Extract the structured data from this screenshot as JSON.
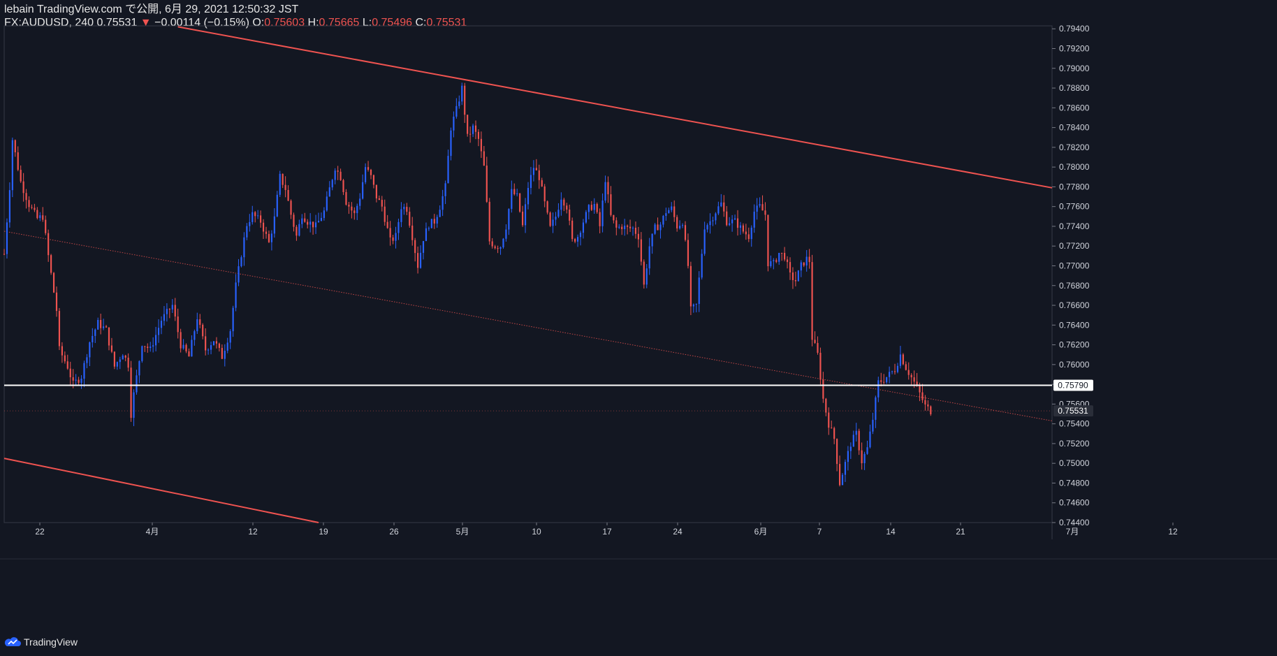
{
  "header": {
    "line1": "lebain TradingView.com で公開, 6月 29, 2021 12:50:32 JST",
    "symbol": "FX:AUDUSD, 240",
    "last": "0.75531",
    "change_arrow": "▼",
    "change": "−0.00114 (−0.15%)",
    "o_label": "O:",
    "o_value": "0.75603",
    "h_label": "H:",
    "h_value": "0.75665",
    "l_label": "L:",
    "l_value": "0.75496",
    "c_label": "C:",
    "c_value": "0.75531"
  },
  "footer": {
    "brand": "TradingView",
    "logo_icon": "tradingview-cloud-icon"
  },
  "colors": {
    "background": "#131722",
    "up": "#2962ff",
    "down": "#ef5350",
    "trendline": "#ef5350",
    "hline": "#ffffff",
    "grid_text": "#d1d4dc"
  },
  "chart_data": {
    "type": "candlestick",
    "symbol": "FX:AUDUSD",
    "timeframe": "240",
    "y_ticks": [
      "0.74400",
      "0.74600",
      "0.74800",
      "0.75000",
      "0.75200",
      "0.75400",
      "0.75600",
      "0.75800",
      "0.76000",
      "0.76200",
      "0.76400",
      "0.76600",
      "0.76800",
      "0.77000",
      "0.77200",
      "0.77400",
      "0.77600",
      "0.77800",
      "0.78000",
      "0.78200",
      "0.78400",
      "0.78600",
      "0.78800",
      "0.79000",
      "0.79200",
      "0.79400"
    ],
    "ylim": [
      0.744,
      0.7943
    ],
    "x_ticks": [
      "22",
      "4月",
      "12",
      "19",
      "26",
      "5月",
      "10",
      "17",
      "24",
      "6月",
      "7",
      "14",
      "21",
      "7月",
      "12"
    ],
    "horizontal_line": {
      "value": 0.7579,
      "label": "0.75790"
    },
    "last_price": {
      "value": 0.75531,
      "label": "0.75531"
    },
    "trendlines": [
      {
        "name": "upper",
        "from": {
          "t": 63,
          "y": 0.7942
        },
        "to": {
          "t": 380,
          "y": 0.7779
        }
      },
      {
        "name": "lower",
        "from": {
          "t": 0,
          "y": 0.7505
        },
        "to": {
          "t": 114,
          "y": 0.744
        }
      },
      {
        "name": "mid-dotted",
        "from": {
          "t": 0,
          "y": 0.7735
        },
        "to": {
          "t": 380,
          "y": 0.7543
        }
      }
    ],
    "price_path": [
      [
        0,
        0.7712
      ],
      [
        2,
        0.778
      ],
      [
        3,
        0.7828
      ],
      [
        6,
        0.7785
      ],
      [
        9,
        0.7762
      ],
      [
        12,
        0.7748
      ],
      [
        14,
        0.775
      ],
      [
        16,
        0.771
      ],
      [
        19,
        0.7655
      ],
      [
        20,
        0.7615
      ],
      [
        23,
        0.7598
      ],
      [
        25,
        0.758
      ],
      [
        28,
        0.7588
      ],
      [
        31,
        0.7623
      ],
      [
        34,
        0.7642
      ],
      [
        37,
        0.7635
      ],
      [
        40,
        0.7598
      ],
      [
        43,
        0.7612
      ],
      [
        45,
        0.76
      ],
      [
        46,
        0.755
      ],
      [
        47,
        0.757
      ],
      [
        50,
        0.7622
      ],
      [
        53,
        0.7615
      ],
      [
        57,
        0.7645
      ],
      [
        61,
        0.766
      ],
      [
        64,
        0.762
      ],
      [
        67,
        0.7608
      ],
      [
        70,
        0.7648
      ],
      [
        73,
        0.7615
      ],
      [
        76,
        0.7625
      ],
      [
        79,
        0.7608
      ],
      [
        82,
        0.7635
      ],
      [
        84,
        0.768
      ],
      [
        86,
        0.7712
      ],
      [
        88,
        0.7742
      ],
      [
        90,
        0.7752
      ],
      [
        93,
        0.7745
      ],
      [
        96,
        0.7723
      ],
      [
        98,
        0.7748
      ],
      [
        100,
        0.779
      ],
      [
        102,
        0.7778
      ],
      [
        104,
        0.7752
      ],
      [
        106,
        0.773
      ],
      [
        108,
        0.7752
      ],
      [
        110,
        0.7745
      ],
      [
        113,
        0.774
      ],
      [
        116,
        0.7755
      ],
      [
        118,
        0.7778
      ],
      [
        120,
        0.78
      ],
      [
        122,
        0.779
      ],
      [
        124,
        0.7765
      ],
      [
        127,
        0.7752
      ],
      [
        129,
        0.777
      ],
      [
        131,
        0.78
      ],
      [
        133,
        0.779
      ],
      [
        135,
        0.777
      ],
      [
        137,
        0.776
      ],
      [
        140,
        0.7725
      ],
      [
        142,
        0.773
      ],
      [
        144,
        0.776
      ],
      [
        146,
        0.7758
      ],
      [
        148,
        0.773
      ],
      [
        150,
        0.77
      ],
      [
        152,
        0.7728
      ],
      [
        154,
        0.7742
      ],
      [
        156,
        0.7745
      ],
      [
        158,
        0.776
      ],
      [
        160,
        0.778
      ],
      [
        162,
        0.784
      ],
      [
        164,
        0.7858
      ],
      [
        166,
        0.788
      ],
      [
        168,
        0.783
      ],
      [
        170,
        0.784
      ],
      [
        172,
        0.7828
      ],
      [
        174,
        0.78
      ],
      [
        176,
        0.7725
      ],
      [
        178,
        0.772
      ],
      [
        180,
        0.772
      ],
      [
        182,
        0.774
      ],
      [
        184,
        0.7775
      ],
      [
        186,
        0.777
      ],
      [
        188,
        0.774
      ],
      [
        190,
        0.778
      ],
      [
        192,
        0.78
      ],
      [
        194,
        0.779
      ],
      [
        196,
        0.7763
      ],
      [
        198,
        0.7738
      ],
      [
        200,
        0.775
      ],
      [
        202,
        0.777
      ],
      [
        204,
        0.776
      ],
      [
        206,
        0.7725
      ],
      [
        208,
        0.773
      ],
      [
        210,
        0.7745
      ],
      [
        212,
        0.7758
      ],
      [
        214,
        0.7762
      ],
      [
        216,
        0.774
      ],
      [
        218,
        0.7788
      ],
      [
        220,
        0.775
      ],
      [
        222,
        0.7738
      ],
      [
        224,
        0.774
      ],
      [
        226,
        0.7738
      ],
      [
        228,
        0.7738
      ],
      [
        230,
        0.773
      ],
      [
        232,
        0.768
      ],
      [
        234,
        0.772
      ],
      [
        236,
        0.7738
      ],
      [
        238,
        0.7742
      ],
      [
        240,
        0.7755
      ],
      [
        242,
        0.7758
      ],
      [
        244,
        0.774
      ],
      [
        246,
        0.7745
      ],
      [
        248,
        0.77
      ],
      [
        249,
        0.7655
      ],
      [
        251,
        0.766
      ],
      [
        254,
        0.774
      ],
      [
        256,
        0.7745
      ],
      [
        258,
        0.7755
      ],
      [
        260,
        0.7763
      ],
      [
        262,
        0.7745
      ],
      [
        265,
        0.7745
      ],
      [
        268,
        0.7735
      ],
      [
        270,
        0.773
      ],
      [
        272,
        0.7755
      ],
      [
        274,
        0.776
      ],
      [
        276,
        0.7752
      ],
      [
        277,
        0.7703
      ],
      [
        279,
        0.7702
      ],
      [
        281,
        0.7713
      ],
      [
        283,
        0.771
      ],
      [
        285,
        0.769
      ],
      [
        287,
        0.7685
      ],
      [
        289,
        0.77
      ],
      [
        291,
        0.7707
      ],
      [
        292,
        0.7705
      ],
      [
        293,
        0.7627
      ],
      [
        295,
        0.761
      ],
      [
        297,
        0.7565
      ],
      [
        299,
        0.754
      ],
      [
        301,
        0.7525
      ],
      [
        303,
        0.748
      ],
      [
        305,
        0.75
      ],
      [
        307,
        0.752
      ],
      [
        309,
        0.753
      ],
      [
        311,
        0.7502
      ],
      [
        313,
        0.7515
      ],
      [
        315,
        0.7545
      ],
      [
        317,
        0.7582
      ],
      [
        319,
        0.7585
      ],
      [
        321,
        0.759
      ],
      [
        323,
        0.7595
      ],
      [
        325,
        0.761
      ],
      [
        327,
        0.7597
      ],
      [
        329,
        0.7587
      ],
      [
        331,
        0.7577
      ],
      [
        334,
        0.7558
      ],
      [
        336,
        0.75531
      ]
    ]
  }
}
